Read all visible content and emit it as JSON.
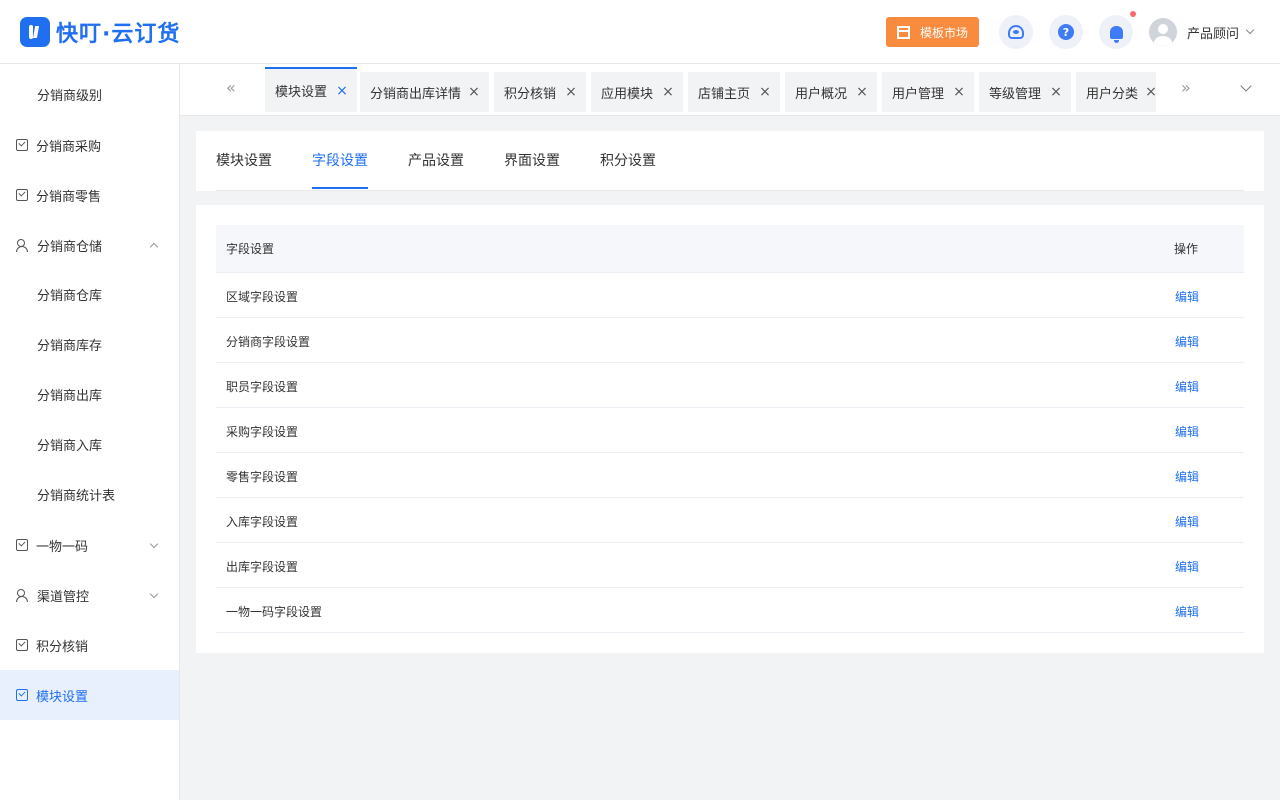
{
  "brand": {
    "name": "快叮·云订货"
  },
  "header": {
    "market_label": "模板市场",
    "user_name": "产品顾问"
  },
  "sidebar": {
    "items": [
      {
        "label": "分销商级别"
      },
      {
        "label": "分销商采购"
      },
      {
        "label": "分销商零售"
      },
      {
        "label": "分销商仓储"
      },
      {
        "label": "分销商仓库"
      },
      {
        "label": "分销商库存"
      },
      {
        "label": "分销商出库"
      },
      {
        "label": "分销商入库"
      },
      {
        "label": "分销商统计表"
      },
      {
        "label": "一物一码"
      },
      {
        "label": "渠道管控"
      },
      {
        "label": "积分核销"
      },
      {
        "label": "模块设置"
      }
    ]
  },
  "tabs": [
    {
      "label": "模块设置",
      "close": "×"
    },
    {
      "label": "分销商出库详情",
      "close": "×"
    },
    {
      "label": "积分核销",
      "close": "×"
    },
    {
      "label": "应用模块",
      "close": "×"
    },
    {
      "label": "店铺主页",
      "close": "×"
    },
    {
      "label": "用户概况",
      "close": "×"
    },
    {
      "label": "用户管理",
      "close": "×"
    },
    {
      "label": "等级管理",
      "close": "×"
    },
    {
      "label": "用户分类",
      "close": "×"
    }
  ],
  "tab_nav": {
    "prev": "«",
    "next": "»"
  },
  "settings_tabs": [
    {
      "label": "模块设置"
    },
    {
      "label": "字段设置"
    },
    {
      "label": "产品设置"
    },
    {
      "label": "界面设置"
    },
    {
      "label": "积分设置"
    }
  ],
  "table": {
    "headers": {
      "name": "字段设置",
      "action": "操作"
    },
    "rows": [
      {
        "name": "区域字段设置",
        "action": "编辑"
      },
      {
        "name": "分销商字段设置",
        "action": "编辑"
      },
      {
        "name": "职员字段设置",
        "action": "编辑"
      },
      {
        "name": "采购字段设置",
        "action": "编辑"
      },
      {
        "name": "零售字段设置",
        "action": "编辑"
      },
      {
        "name": "入库字段设置",
        "action": "编辑"
      },
      {
        "name": "出库字段设置",
        "action": "编辑"
      },
      {
        "name": "一物一码字段设置",
        "action": "编辑"
      }
    ]
  },
  "colors": {
    "accent": "#1f6ff0",
    "market_button": "#f98b3e",
    "notification": "#f56c6c"
  }
}
